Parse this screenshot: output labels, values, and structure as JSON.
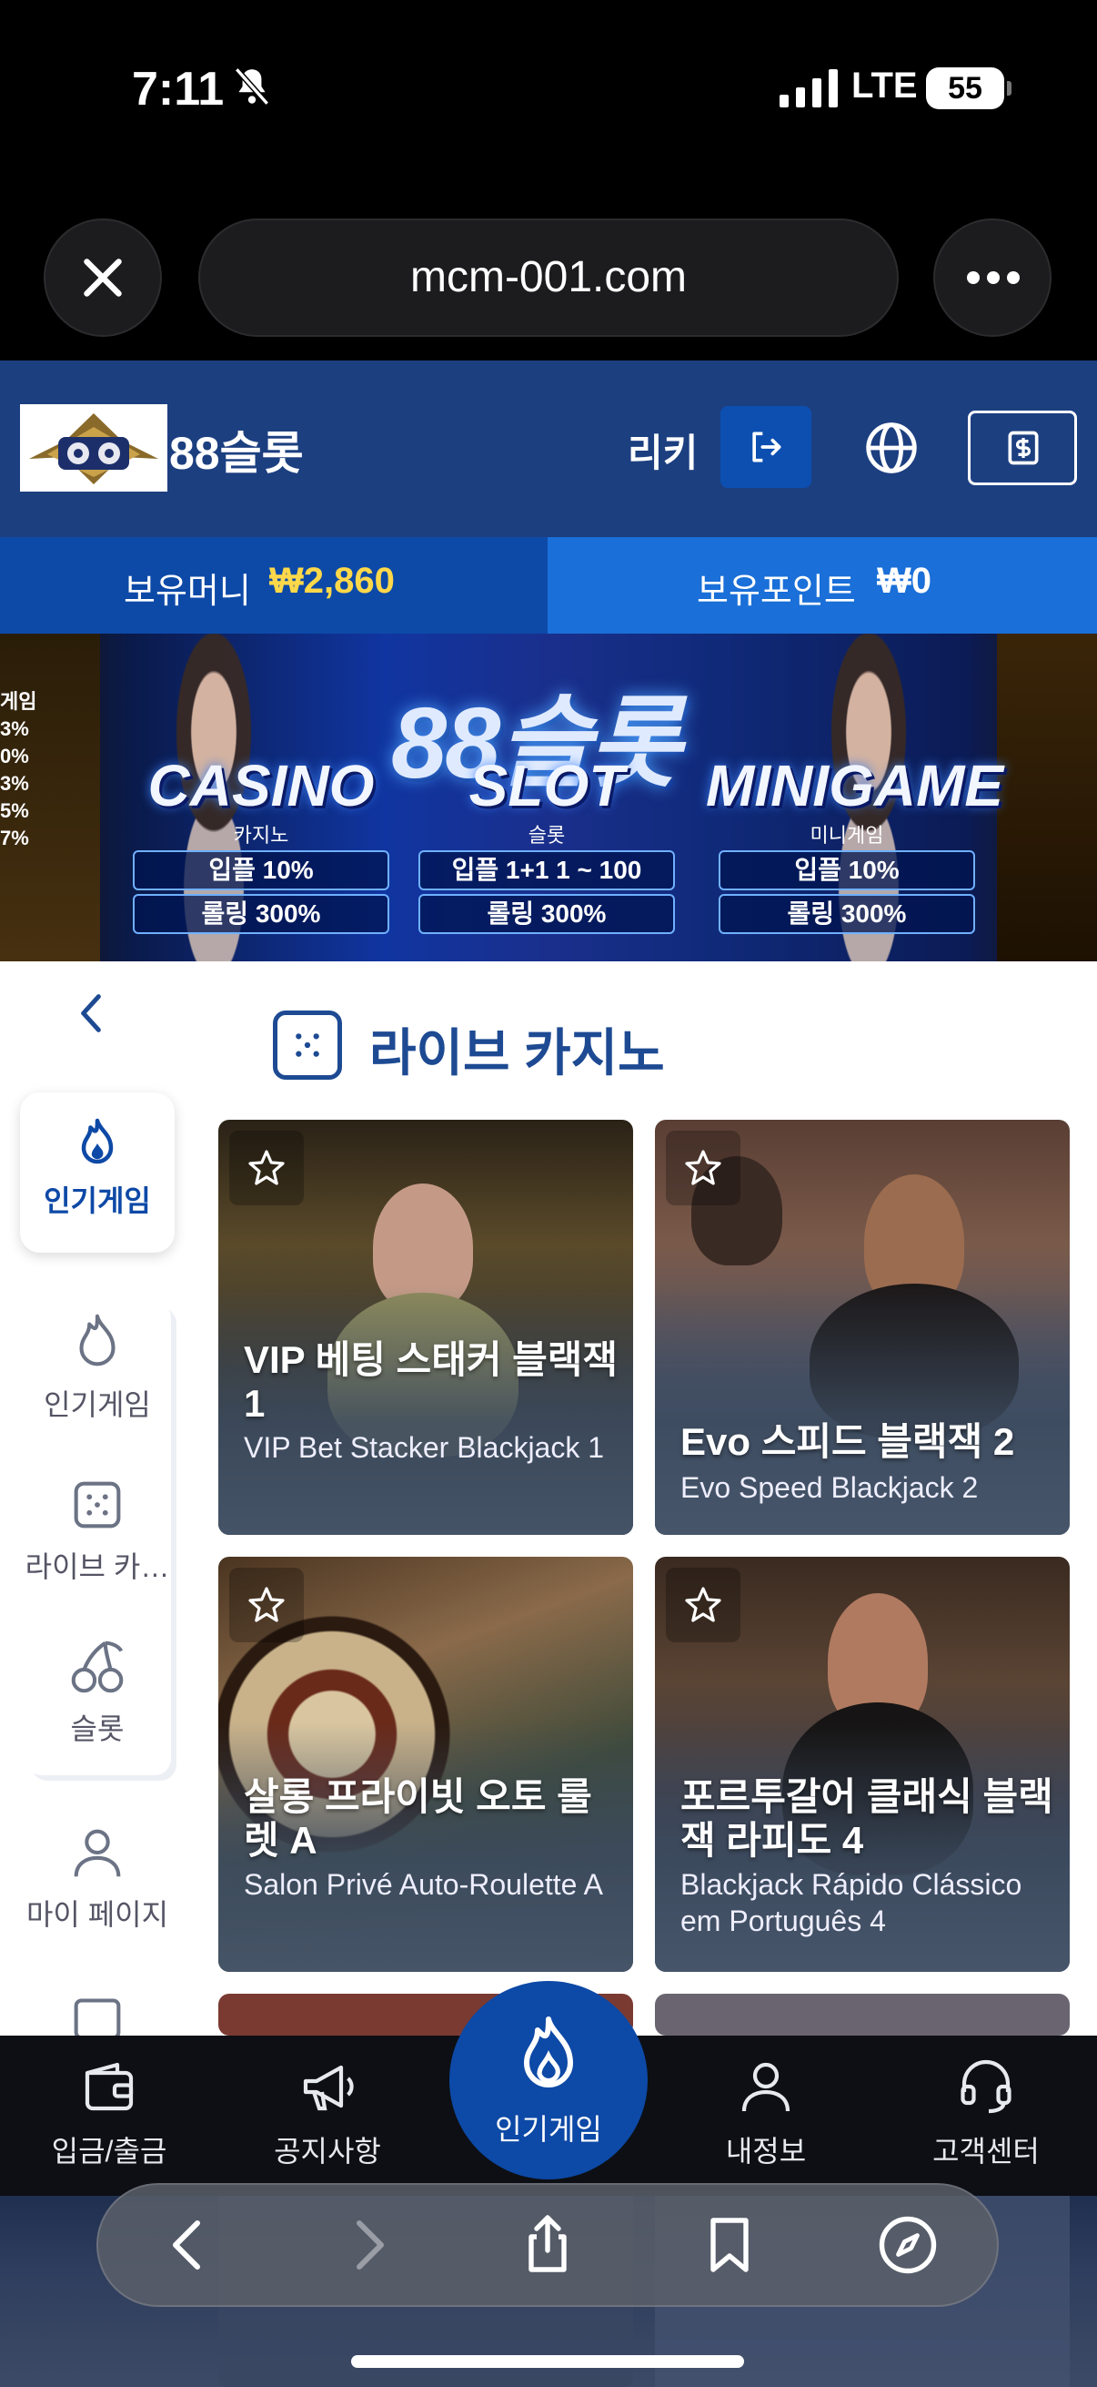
{
  "status": {
    "time": "7:11",
    "network": "LTE",
    "battery": "55"
  },
  "browser": {
    "url": "mcm-001.com"
  },
  "header": {
    "site_title": "88슬롯",
    "username": "리키"
  },
  "balance": {
    "money_label": "보유머니",
    "money_value": "₩2,860",
    "points_label": "보유포인트",
    "points_value": "₩0"
  },
  "banner": {
    "headline": "88슬롯",
    "left_edge_rates": [
      "게임",
      "3%",
      "0%",
      "3%",
      "5%",
      "7%"
    ],
    "cards": [
      {
        "title": "CASINO",
        "sub": "카지노",
        "row1": "입플 10%",
        "row2": "롤링 300%"
      },
      {
        "title": "SLOT",
        "sub": "슬롯",
        "row1": "입플 1+1 1 ~ 100",
        "row2": "롤링 300%"
      },
      {
        "title": "MINIGAME",
        "sub": "미니게임",
        "row1": "입플 10%",
        "row2": "롤링 300%"
      }
    ]
  },
  "sidebar": {
    "active": "인기게임",
    "items": [
      {
        "label": "인기게임",
        "icon": "flame-icon"
      },
      {
        "label": "라이브 카…",
        "icon": "dice-icon"
      },
      {
        "label": "슬롯",
        "icon": "cherry-icon"
      },
      {
        "label": "마이 페이지",
        "icon": "user-icon"
      }
    ]
  },
  "section": {
    "title": "라이브 카지노"
  },
  "games": [
    {
      "title": "VIP 베팅 스태커 블랙잭 1",
      "sub": "VIP Bet Stacker Blackjack 1"
    },
    {
      "title": "Evo 스피드 블랙잭 2",
      "sub": "Evo Speed Blackjack 2"
    },
    {
      "title": "살롱 프라이빗 오토 룰렛 A",
      "sub": "Salon Privé Auto-Roulette A"
    },
    {
      "title": "포르투갈어 클래식 블랙잭 라피도 4",
      "sub": "Blackjack Rápido Clássico em Português 4"
    }
  ],
  "bottom_nav": [
    {
      "label": "입금/출금",
      "icon": "wallet-icon"
    },
    {
      "label": "공지사항",
      "icon": "megaphone-icon"
    },
    {
      "label": "인기게임",
      "icon": "flame-icon"
    },
    {
      "label": "내정보",
      "icon": "user-icon"
    },
    {
      "label": "고객센터",
      "icon": "headset-icon"
    }
  ]
}
